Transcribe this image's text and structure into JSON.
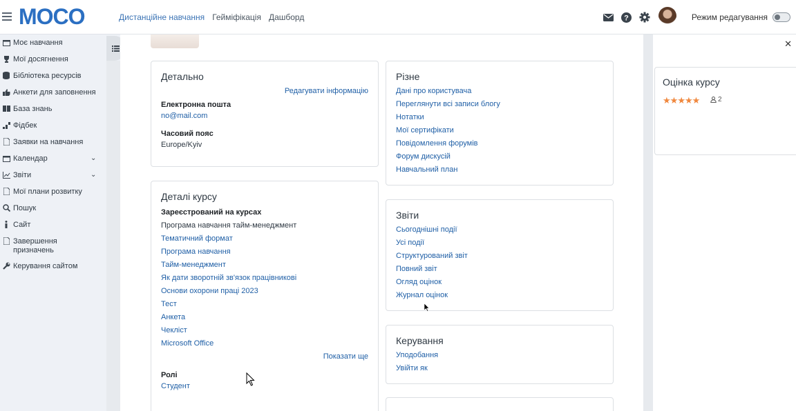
{
  "header": {
    "logo_text": "MOCO",
    "nav": [
      "Дистанційне навчання",
      "Гейміфікація",
      "Дашборд"
    ],
    "edit_mode_label": "Режим редагування",
    "icons": [
      "envelope-icon",
      "help-icon",
      "gear-icon"
    ]
  },
  "sidebar": {
    "items": [
      {
        "label": "Моє навчання",
        "icon": "calendar-icon"
      },
      {
        "label": "Мої досягнення",
        "icon": "trophy-icon"
      },
      {
        "label": "Бібліотека ресурсів",
        "icon": "database-icon"
      },
      {
        "label": "Анкети для заповнення",
        "icon": "thumbs-up-icon"
      },
      {
        "label": "База знань",
        "icon": "book-icon"
      },
      {
        "label": "Фідбек",
        "icon": "chart-icon"
      },
      {
        "label": "Заявки на навчання",
        "icon": "file-icon"
      },
      {
        "label": "Календар",
        "icon": "calendar-icon"
      },
      {
        "label": "Звіти",
        "icon": "chart-line-icon"
      },
      {
        "label": "Мої плани розвитку",
        "icon": "file-icon"
      },
      {
        "label": "Пошук",
        "icon": "search-icon"
      },
      {
        "label": "Сайт",
        "icon": "info-icon"
      },
      {
        "label": "Завершення призначень",
        "icon": "file-icon"
      },
      {
        "label": "Керування сайтом",
        "icon": "wrench-icon"
      }
    ]
  },
  "details": {
    "title": "Детально",
    "edit_link": "Редагувати інформацію",
    "email_label": "Електронна пошта",
    "email_value": "no@mail.com",
    "timezone_label": "Часовий пояс",
    "timezone_value": "Europe/Kyiv"
  },
  "course_details": {
    "title": "Деталі курсу",
    "enrolled_label": "Зареєстрований на курсах",
    "courses": [
      "Програма навчання тайм-менеджмент",
      "Тематичний формат",
      "Програма навчання",
      "Тайм-менеджмент",
      "Як дати зворотній зв'язок працівникові",
      "Основи охорони праці 2023",
      "Тест",
      "Анкета",
      "Чекліст",
      "Microsoft Office"
    ],
    "show_more": "Показати ще",
    "roles_label": "Ролі",
    "role_value": "Студент"
  },
  "misc": {
    "title": "Різне",
    "links": [
      "Дані про користувача",
      "Переглянути всі записи блогу",
      "Нотатки",
      "Мої сертифікати",
      "Повідомлення форумів",
      "Форум дискусій",
      "Навчальний план"
    ]
  },
  "reports": {
    "title": "Звіти",
    "links": [
      "Сьогоднішні події",
      "Усі події",
      "Структурований звіт",
      "Повний звіт",
      "Огляд оцінок",
      "Журнал оцінок"
    ]
  },
  "management": {
    "title": "Керування",
    "links": [
      "Уподобання",
      "Увійти як"
    ]
  },
  "rating": {
    "title": "Оцінка курсу",
    "stars": 5,
    "count": "2"
  },
  "colors": {
    "accent": "#1f5fa6",
    "logo": "#2b6fc2",
    "stars": "#f0883e"
  }
}
